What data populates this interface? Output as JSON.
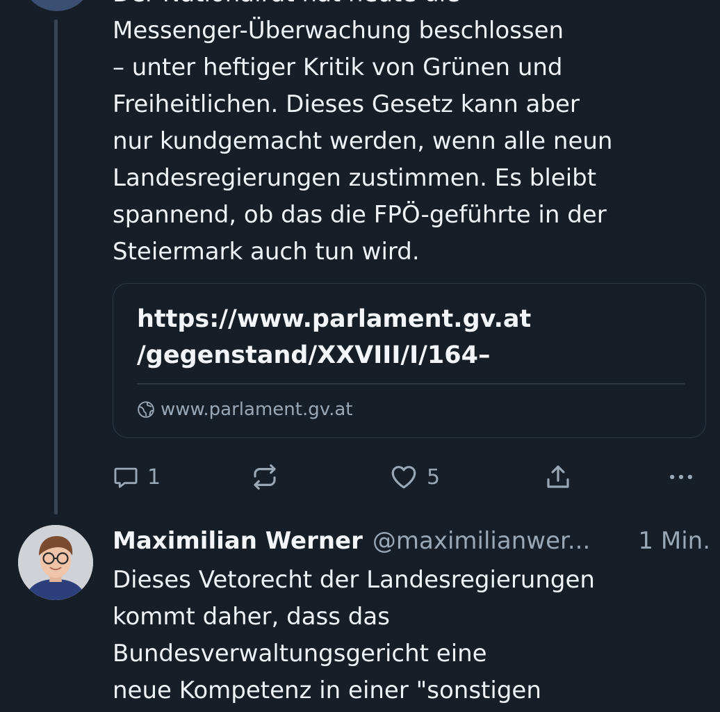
{
  "post1": {
    "lines": [
      "Der Nationalrat hat heute die",
      "Messenger-Überwachung beschlossen",
      "– unter heftiger Kritik von Grünen und",
      "Freiheitlichen. Dieses Gesetz kann aber",
      "nur kundgemacht werden, wenn alle neun",
      "Landesregierungen zustimmen. Es bleibt",
      "spannend, ob das die FPÖ-geführte in der",
      "Steiermark auch tun wird."
    ],
    "link_card": {
      "title_line1": "https://www.parlament.gv.at",
      "title_line2": "/gegenstand/XXVIII/I/164–",
      "domain": "www.parlament.gv.at",
      "domain_icon": "globe-icon"
    },
    "actions": {
      "reply_icon": "reply-icon",
      "reply_count": "1",
      "repost_icon": "repost-icon",
      "like_icon": "heart-icon",
      "like_count": "5",
      "share_icon": "share-icon",
      "more_icon": "more-icon"
    }
  },
  "post2": {
    "author_name": "Maximilian Werner",
    "author_handle": "@maximilianwer...",
    "time": "1 Min.",
    "lines": [
      "Dieses Vetorecht der Landesregierungen",
      "kommt daher, dass das",
      "Bundesverwaltungsgericht eine",
      "neue Kompetenz in einer \"sonstigen"
    ]
  },
  "colors": {
    "background": "#161e27",
    "text": "#eef3f8",
    "muted": "#9aa8b6",
    "border": "#2e3944"
  }
}
